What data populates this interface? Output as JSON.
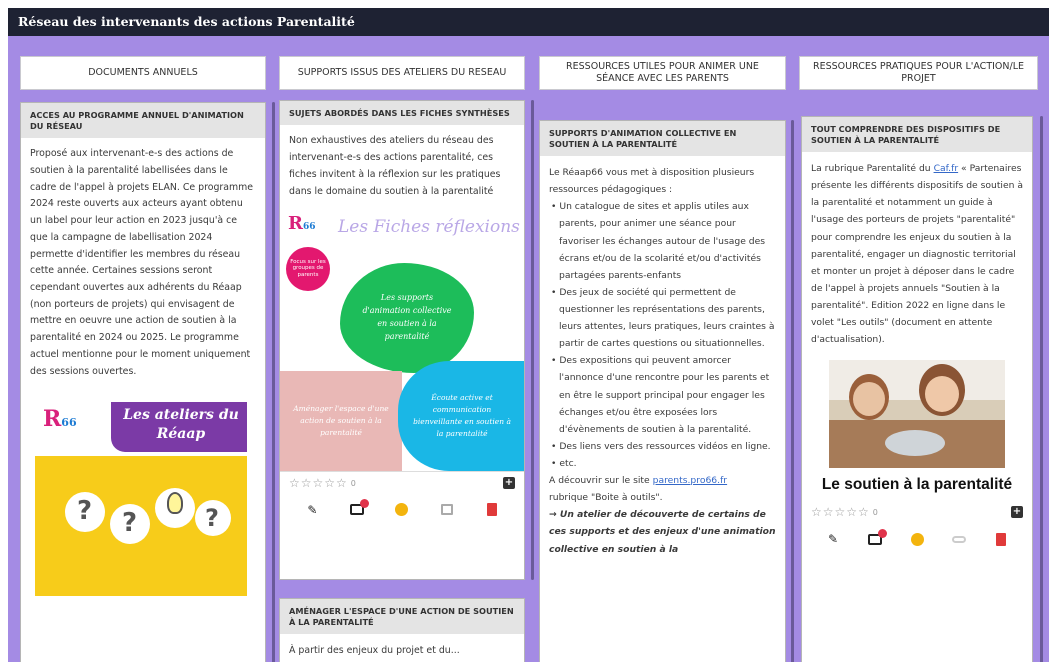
{
  "header": {
    "title": "Réseau des intervenants des actions Parentalité"
  },
  "columns": [
    {
      "label": "DOCUMENTS ANNUELS"
    },
    {
      "label": "SUPPORTS ISSUS DES ATELIERS DU RESEAU"
    },
    {
      "label": "RESSOURCES UTILES POUR ANIMER UNE SÉANCE AVEC LES PARENTS"
    },
    {
      "label": "RESSOURCES PRATIQUES POUR L'ACTION/LE PROJET"
    }
  ],
  "col1": {
    "card1": {
      "title": "ACCES AU PROGRAMME ANNUEL D'ANIMATION DU RÉSEAU",
      "body": "Proposé aux intervenant-e-s des actions de soutien à la parentalité labellisées dans le cadre de l'appel à projets ELAN. Ce programme 2024 reste ouverts aux acteurs ayant obtenu un label pour leur action en 2023 jusqu'à ce que la campagne de labellisation 2024 permette d'identifier les membres du réseau cette année. Certaines sessions seront cependant ouvertes aux adhérents du Réaap (non porteurs de projets) qui envisagent de mettre en oeuvre une action de soutien à la parentalité en 2024 ou 2025. Le programme actuel mentionne pour le moment uniquement des sessions ouvertes.",
      "poster": {
        "logo_text": "R",
        "logo_num": "66",
        "title_line1": "Les ateliers du",
        "title_line2": "Réaap"
      }
    }
  },
  "col2": {
    "card1": {
      "title": "SUJETS ABORDÉS DANS LES FICHES SYNTHÈSES",
      "body": "Non exhaustives des ateliers du réseau des intervenant-e-s des actions parentalité, ces fiches invitent à la réflexion sur les pratiques dans le domaine du soutien à la parentalité",
      "poster": {
        "logo_text": "R",
        "logo_num": "66",
        "headline": "Les Fiches réflexions",
        "badge": "Focus sur les groupes de parents",
        "green_blob": "Les supports d'animation collective en soutien à la parentalité",
        "pink_blob": "Aménager l'espace d'une action de soutien à la parentalité",
        "blue_blob": "Écoute active et communication bienveillante en soutien à la parentalité"
      },
      "rating": {
        "stars": "☆☆☆☆☆",
        "count": "0"
      }
    },
    "card2": {
      "title": "AMÉNAGER L'ESPACE D'UNE ACTION DE SOUTIEN À LA PARENTALITÉ",
      "body": "À partir des enjeux du projet et du..."
    }
  },
  "col3": {
    "card1": {
      "title": "SUPPORTS D'ANIMATION COLLECTIVE EN SOUTIEN À LA PARENTALITÉ",
      "intro": "Le Réaap66 vous met à disposition plusieurs ressources pédagogiques :",
      "items": [
        "Un catalogue de sites et applis utiles aux parents, pour animer une séance pour favoriser les échanges autour de l'usage des écrans et/ou de la scolarité et/ou d'activités partagées parents-enfants",
        "Des jeux de société qui permettent de questionner les représentations des parents, leurs attentes, leurs pratiques, leurs craintes à partir de cartes questions ou situationnelles.",
        "Des expositions qui peuvent amorcer l'annonce d'une rencontre pour les parents et en être le support principal pour engager les échanges et/ou être exposées lors d'évènements de soutien à la parentalité.",
        "Des liens vers des ressources vidéos en ligne.",
        "etc."
      ],
      "site_prefix": "A découvrir sur le site ",
      "site_link": "parents.pro66.fr",
      "site_suffix": "rubrique \"Boite à outils\".",
      "bold_note": "→ Un atelier de découverte de certains de ces supports et des enjeux d'une animation collective en soutien à la"
    }
  },
  "col4": {
    "card1": {
      "title": "TOUT COMPRENDRE DES DISPOSITIFS DE SOUTIEN À LA PARENTALITÉ",
      "body_prefix": "La rubrique Parentalité du ",
      "body_link": "Caf.fr",
      "body_rest": " « Partenaires présente les différents dispositifs de soutien à la parentalité et notamment un guide à l'usage des porteurs de projets \"parentalité\" pour comprendre les enjeux du soutien à la parentalité, engager un diagnostic territorial et monter un projet à déposer dans le cadre de l'appel à projets annuels \"Soutien à la parentalité\". Edition 2022 en ligne dans le volet \"Les outils\" (document en attente d'actualisation).",
      "caption": "Le soutien à la parentalité",
      "rating": {
        "stars": "☆☆☆☆☆",
        "count": "0"
      }
    }
  },
  "colors": {
    "board": "#a48be4",
    "topbar": "#1e2233",
    "green": "#1dbd5a",
    "pink": "#e9b8b6",
    "blue": "#1ab7e6",
    "purple": "#7b3aa6",
    "yellow": "#f7cc1a"
  }
}
